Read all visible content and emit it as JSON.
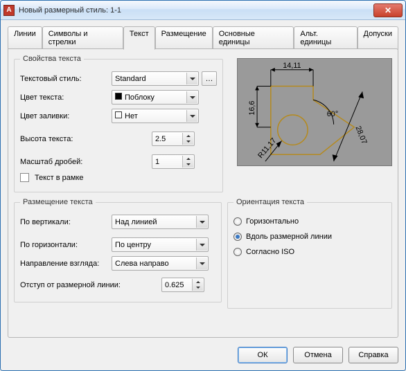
{
  "window": {
    "title": "Новый размерный стиль: 1-1"
  },
  "tabs": [
    "Линии",
    "Символы и стрелки",
    "Текст",
    "Размещение",
    "Основные единицы",
    "Альт. единицы",
    "Допуски"
  ],
  "activeTab": 2,
  "textProps": {
    "legend": "Свойства текста",
    "style_label": "Текстовый стиль:",
    "style_value": "Standard",
    "textcolor_label": "Цвет текста:",
    "textcolor_value": "Поблоку",
    "fillcolor_label": "Цвет заливки:",
    "fillcolor_value": "Нет",
    "height_label": "Высота текста:",
    "height_value": "2.5",
    "frac_label": "Масштаб дробей:",
    "frac_value": "1",
    "frame_label": "Текст в рамке"
  },
  "placement": {
    "legend": "Размещение текста",
    "vert_label": "По вертикали:",
    "vert_value": "Над линией",
    "horiz_label": "По горизонтали:",
    "horiz_value": "По центру",
    "dir_label": "Направление взгляда:",
    "dir_value": "Слева направо",
    "offset_label": "Отступ от размерной линии:",
    "offset_value": "0.625"
  },
  "orientation": {
    "legend": "Ориентация текста",
    "opt1": "Горизонтально",
    "opt2": "Вдоль размерной линии",
    "opt3": "Согласно ISO"
  },
  "preview": {
    "d1": "14,11",
    "d2": "16,6",
    "d3": "28,07",
    "d4": "R11,17",
    "d5": "60°"
  },
  "buttons": {
    "ok": "ОК",
    "cancel": "Отмена",
    "help": "Справка"
  }
}
